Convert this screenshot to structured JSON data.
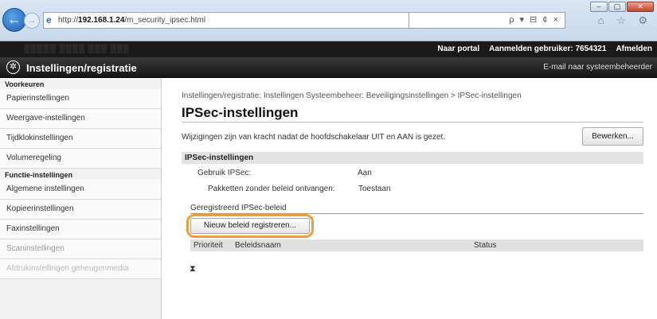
{
  "browser": {
    "url_prefix": "http://",
    "url_host": "192.168.1.24",
    "url_path": "/m_security_ipsec.html",
    "search_icons": "ρ ▾ ⊟ ¢ ×",
    "toolbar_icons": "⌂ ☆ ⚙",
    "window_buttons": {
      "minimize": "‒",
      "maximize": "▢",
      "close": "✕"
    }
  },
  "topbar": {
    "device_name": "░░░░░  ░░░░ ░░░ ░░░",
    "portal_link": "Naar portal",
    "login_label": "Aanmelden gebruiker:",
    "user_id": "7654321",
    "logout_link": "Afmelden"
  },
  "header": {
    "logo_glyph": "✲",
    "title": "Instellingen/registratie",
    "mail_link": "E-mail naar systeembeheerder"
  },
  "sidebar": {
    "heading_prefs": "Voorkeuren",
    "prefs_items": [
      "Papierinstellingen",
      "Weergave-instellingen",
      "Tijdklokinstellingen",
      "Volumeregeling"
    ],
    "heading_functions": "Functie-instellingen",
    "function_items": [
      "Algemene instellingen",
      "Kopieerinstellingen",
      "Faxinstellingen",
      "Scaninstellingen",
      "Afdrukinstellingen geheugenmedia"
    ]
  },
  "main": {
    "breadcrumb": "Instellingen/registratie: Instellingen Systeembeheer: Beveiligingsinstellingen > IPSec-instellingen",
    "title": "IPSec-instellingen",
    "notice": "Wijzigingen zijn van kracht nadat de hoofdschakelaar UIT en AAN is gezet.",
    "edit_button": "Bewerken...",
    "section_title": "IPSec-instellingen",
    "use_ipsec_label": "Gebruik IPSec:",
    "use_ipsec_value": "Aan",
    "packets_label": "Pakketten zonder beleid ontvangen:",
    "packets_value": "Toestaan",
    "registered_heading": "Geregistreerd IPSec-beleid",
    "register_button": "Nieuw beleid registreren...",
    "table_headers": {
      "priority": "Prioriteit",
      "policy_name": "Beleidsnaam",
      "status": "Status"
    },
    "scroll_top_glyph": "⧗"
  }
}
